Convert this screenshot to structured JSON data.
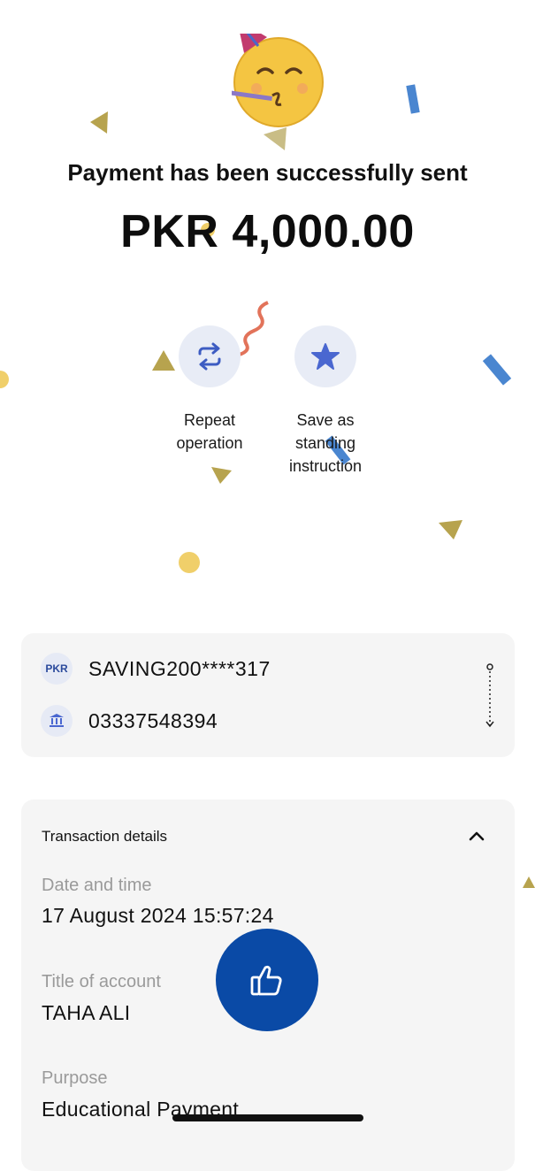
{
  "success": {
    "headline": "Payment has been successfully sent",
    "amount": "PKR 4,000.00"
  },
  "actions": [
    {
      "label": "Repeat\noperation",
      "icon": "repeat-icon"
    },
    {
      "label": "Save as\nstanding\ninstruction",
      "icon": "star-icon"
    }
  ],
  "accounts": {
    "from": {
      "badge": "PKR",
      "number": "SAVING200****317"
    },
    "to": {
      "icon": "bank-icon",
      "number": "03337548394"
    }
  },
  "transaction_details": {
    "title": "Transaction details",
    "fields": [
      {
        "label": "Date and time",
        "value": "17 August 2024 15:57:24"
      },
      {
        "label": "Title of account",
        "value": "TAHA ALI"
      },
      {
        "label": "Purpose",
        "value": "Educational Payment"
      }
    ]
  },
  "colors": {
    "accent": "#0a4aa6",
    "action_bg": "#e8ecf6",
    "card_bg": "#f5f5f5",
    "label_gray": "#9a9a9a"
  },
  "icons": [
    "party-emoji-icon",
    "repeat-icon",
    "star-icon",
    "bank-icon",
    "chevron-up-icon",
    "thumbs-up-icon",
    "flow-arrow-icon"
  ]
}
